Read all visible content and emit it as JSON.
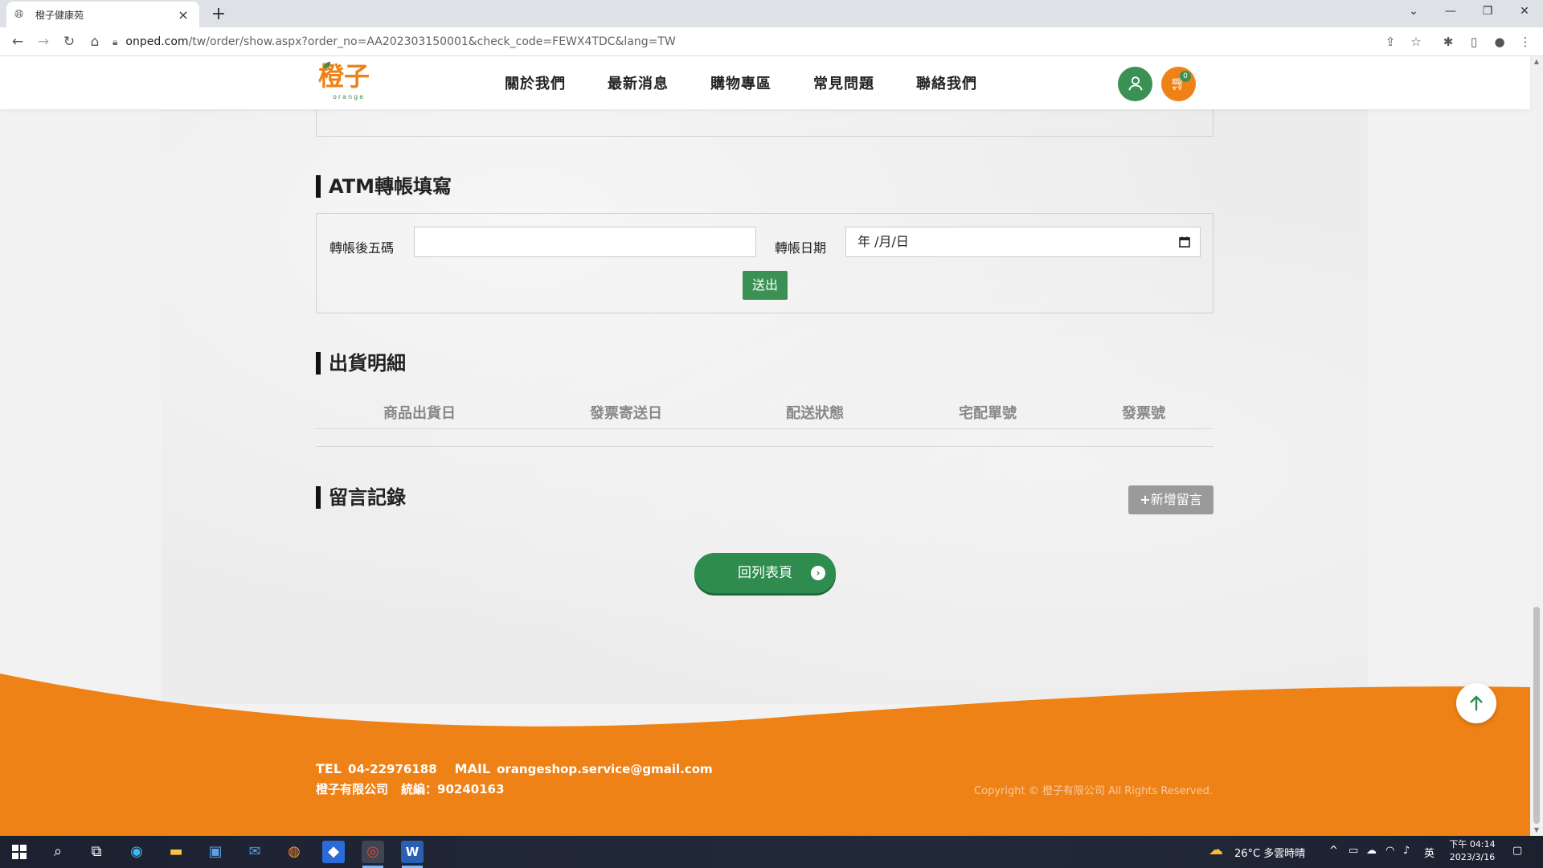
{
  "browser": {
    "tab_title": "橙子健康苑",
    "url_host": "onped.com",
    "url_path": "/tw/order/show.aspx?order_no=AA202303150001&check_code=FEWX4TDC&lang=TW"
  },
  "header": {
    "logo_text": "橙子",
    "logo_sub": "orange",
    "nav": [
      "關於我們",
      "最新消息",
      "購物專區",
      "常見問題",
      "聯絡我們"
    ],
    "cart_count": "0"
  },
  "atm": {
    "title": "ATM轉帳填寫",
    "last5_label": "轉帳後五碼",
    "last5_value": "",
    "date_label": "轉帳日期",
    "date_placeholder": "年 /月/日",
    "submit_label": "送出"
  },
  "shipping": {
    "title": "出貨明細",
    "columns": [
      "商品出貨日",
      "發票寄送日",
      "配送狀態",
      "宅配單號",
      "發票號"
    ]
  },
  "messages": {
    "title": "留言記錄",
    "add_label": "新增留言"
  },
  "back_label": "回列表頁",
  "footer": {
    "tel_label": "TEL",
    "tel": "04-22976188",
    "mail_label": "MAIL",
    "mail": "orangeshop.service@gmail.com",
    "company": "橙子有限公司",
    "tax_label": "統編：",
    "tax_id": "90240163",
    "copyright": "Copyright © 橙子有限公司 All Rights Reserved."
  },
  "taskbar": {
    "weather": "26°C 多雲時晴",
    "ime": "英",
    "time": "下午 04:14",
    "date": "2023/3/16"
  },
  "colors": {
    "brand_orange": "#ef8217",
    "brand_green": "#3b9154",
    "gray_button": "#9a9a9a"
  }
}
